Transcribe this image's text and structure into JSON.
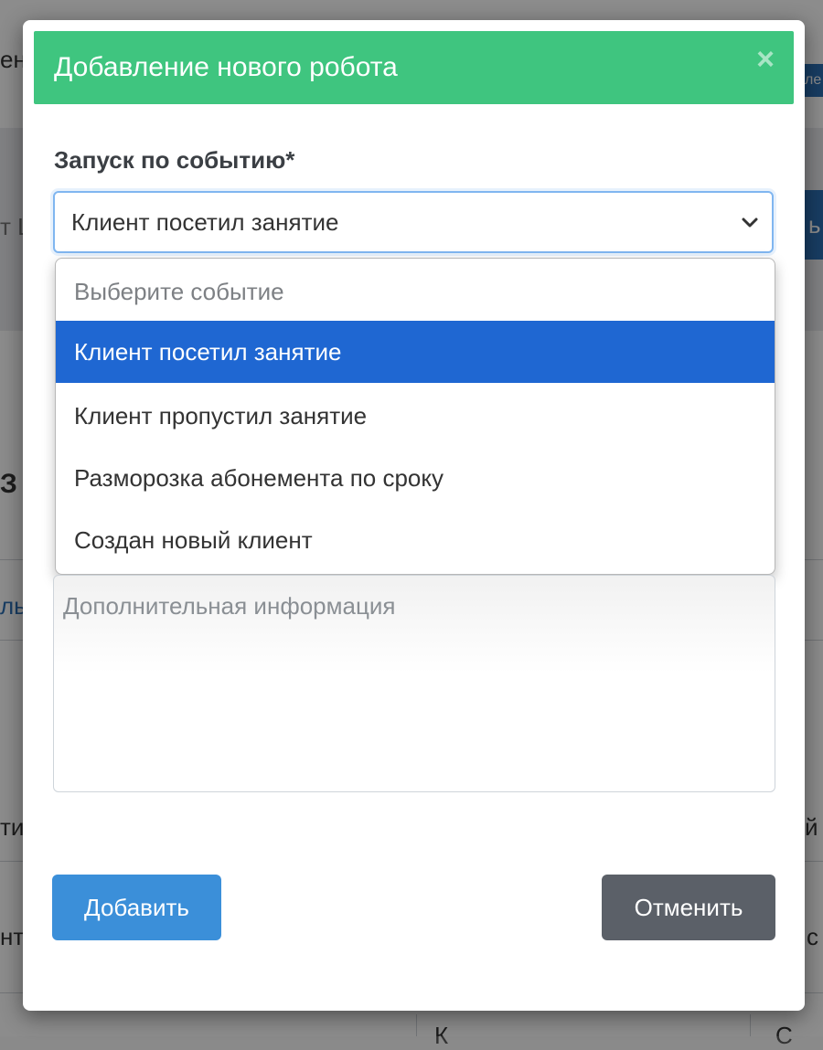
{
  "background": {
    "fragments": [
      "ен",
      "ле",
      "т Ц",
      "ь",
      "З",
      "ль",
      "ти",
      "й",
      "нт",
      "с",
      "К",
      "С"
    ]
  },
  "modal": {
    "title": "Добавление нового робота",
    "close_glyph": "×",
    "header_color": "#3fc57f"
  },
  "event_field": {
    "label": "Запуск по событию*",
    "selected_value": "Клиент посетил занятие",
    "options": [
      "Выберите событие",
      "Клиент посетил занятие",
      "Клиент пропустил занятие",
      "Разморозка абонемента по сроку",
      "Создан новый клиент"
    ],
    "selected_index": 1
  },
  "extra_info": {
    "placeholder": "Дополнительная информация"
  },
  "buttons": {
    "add": "Добавить",
    "cancel": "Отменить"
  }
}
